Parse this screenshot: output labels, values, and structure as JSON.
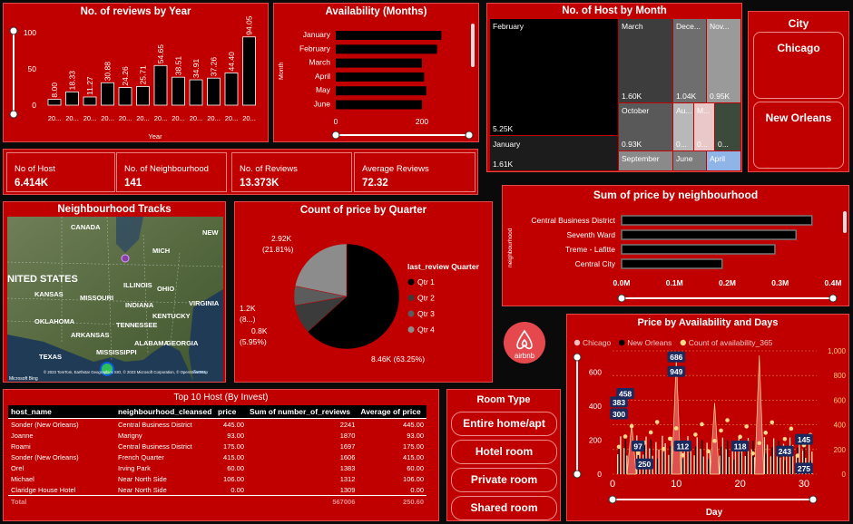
{
  "reviews_by_year": {
    "title": "No. of reviews by Year",
    "xlabel": "Year",
    "yticks": [
      "100",
      "50",
      "0"
    ],
    "bars": [
      {
        "label": "8.00",
        "x": "20..."
      },
      {
        "label": "18.33",
        "x": "20..."
      },
      {
        "label": "11.27",
        "x": "20..."
      },
      {
        "label": "30.88",
        "x": "20..."
      },
      {
        "label": "24.26",
        "x": "20..."
      },
      {
        "label": "25.71",
        "x": "20..."
      },
      {
        "label": "54.65",
        "x": "20..."
      },
      {
        "label": "38.51",
        "x": "20..."
      },
      {
        "label": "34.91",
        "x": "20..."
      },
      {
        "label": "37.26",
        "x": "20..."
      },
      {
        "label": "44.40",
        "x": "20..."
      },
      {
        "label": "94.05",
        "x": "20..."
      }
    ]
  },
  "availability": {
    "title": "Availability (Months)",
    "ylabel": "Month",
    "months": [
      "January",
      "February",
      "March",
      "April",
      "May",
      "June"
    ],
    "values": [
      245,
      235,
      200,
      205,
      210,
      200
    ],
    "xticks": [
      "0",
      "200"
    ]
  },
  "host_by_month": {
    "title": "No. of Host by Month",
    "cells": [
      {
        "name": "February",
        "value": "5.25K"
      },
      {
        "name": "January",
        "value": "1.61K"
      },
      {
        "name": "March",
        "value": "1.60K"
      },
      {
        "name": "Dece...",
        "value": "1.04K"
      },
      {
        "name": "Nov...",
        "value": "0.95K"
      },
      {
        "name": "October",
        "value": "0.93K"
      },
      {
        "name": "September",
        "value": ""
      },
      {
        "name": "Au...",
        "value": "0..."
      },
      {
        "name": "M...",
        "value": "0..."
      },
      {
        "name": "",
        "value": "0..."
      },
      {
        "name": "June",
        "value": ""
      },
      {
        "name": "April",
        "value": ""
      }
    ]
  },
  "city": {
    "title": "City",
    "options": [
      "Chicago",
      "New Orleans"
    ]
  },
  "kpis": [
    {
      "label": "No of Host",
      "value": "6.414K"
    },
    {
      "label": "No. of Neighbourhood",
      "value": "141"
    },
    {
      "label": "No. of Reviews",
      "value": "13.373K"
    },
    {
      "label": "Average Reviews",
      "value": "72.32"
    }
  ],
  "map": {
    "title": "Neighbourhood Tracks",
    "labels": [
      "NITED STATES",
      "CANADA",
      "KANSAS",
      "MISSOURI",
      "ILLINOIS",
      "INDIANA",
      "OHIO",
      "TENNESSEE",
      "OKLAHOMA",
      "MISSISSIPPI",
      "TEXAS",
      "GEORGIA",
      "ALABAMA",
      "KENTUCKY",
      "VIRGINIA",
      "ARKANSAS",
      "NEW",
      "MICH"
    ],
    "attribution": "© 2023 TomTom, Earthstar Geographics SIO, © 2023 Microsoft Corporation, © OpenStreetMap",
    "terms": "Terms",
    "brand": "Microsoft Bing"
  },
  "quarter_pie": {
    "title": "Count of price by Quarter",
    "legend_title": "last_review Quarter",
    "legend": [
      "Qtr 1",
      "Qtr 2",
      "Qtr 3",
      "Qtr 4"
    ],
    "labels": [
      {
        "v": "8.46K (63.25%)"
      },
      {
        "v": "2.92K"
      },
      {
        "v": "(21.81%)"
      },
      {
        "v": "1.2K"
      },
      {
        "v": "(8...)"
      },
      {
        "v": "0.8K"
      },
      {
        "v": "(5.95%)"
      }
    ]
  },
  "price_neigh": {
    "title": "Sum of price by neighbourhood",
    "ylabel": "neighbourhood",
    "rows": [
      {
        "name": "Central Business District",
        "value": 0.36
      },
      {
        "name": "Seventh Ward",
        "value": 0.33
      },
      {
        "name": "Treme - Lafitte",
        "value": 0.29
      },
      {
        "name": "Central City",
        "value": 0.19
      }
    ],
    "xticks": [
      "0.0M",
      "0.1M",
      "0.2M",
      "0.3M",
      "0.4M"
    ]
  },
  "airbnb": {
    "text": "airbnb"
  },
  "price_avail": {
    "title": "Price by Availability and Days",
    "legend": [
      "Chicago",
      "New Orleans",
      "Count of availability_365"
    ],
    "legend_colors": [
      "#f0c0c0",
      "#000000",
      "#f5d98a"
    ],
    "xlabel": "Day",
    "xticks": [
      "0",
      "10",
      "20",
      "30"
    ],
    "yticks_left": [
      "600",
      "400",
      "200",
      "0"
    ],
    "yticks_right": [
      "1,000",
      "800",
      "600",
      "400",
      "200",
      "0"
    ],
    "data_labels": [
      "686",
      "949",
      "458",
      "383",
      "300",
      "97",
      "250",
      "112",
      "118",
      "145",
      "243",
      "275"
    ]
  },
  "top_hosts": {
    "title": "Top 10 Host (By Invest)",
    "columns": [
      "host_name",
      "neighbourhood_cleansed",
      "price",
      "Sum of number_of_reviews",
      "Average of price"
    ],
    "rows": [
      [
        "Sonder (New Orleans)",
        "Central Business District",
        "445.00",
        "2241",
        "445.00"
      ],
      [
        "Joanne",
        "Marigny",
        "93.00",
        "1870",
        "93.00"
      ],
      [
        "Roami",
        "Central Business District",
        "175.00",
        "1697",
        "175.00"
      ],
      [
        "Sonder (New Orleans)",
        "French Quarter",
        "415.00",
        "1606",
        "415.00"
      ],
      [
        "Orel",
        "Irving Park",
        "60.00",
        "1383",
        "60.00"
      ],
      [
        "Michael",
        "Near North Side",
        "106.00",
        "1312",
        "106.00"
      ],
      [
        "Claridge House Hotel",
        "Near North Side",
        "0.00",
        "1309",
        "0.00"
      ]
    ],
    "total": [
      "Total",
      "",
      "",
      "567006",
      "250.60"
    ]
  },
  "room_type": {
    "title": "Room Type",
    "options": [
      "Entire home/apt",
      "Hotel room",
      "Private room",
      "Shared room"
    ]
  }
}
